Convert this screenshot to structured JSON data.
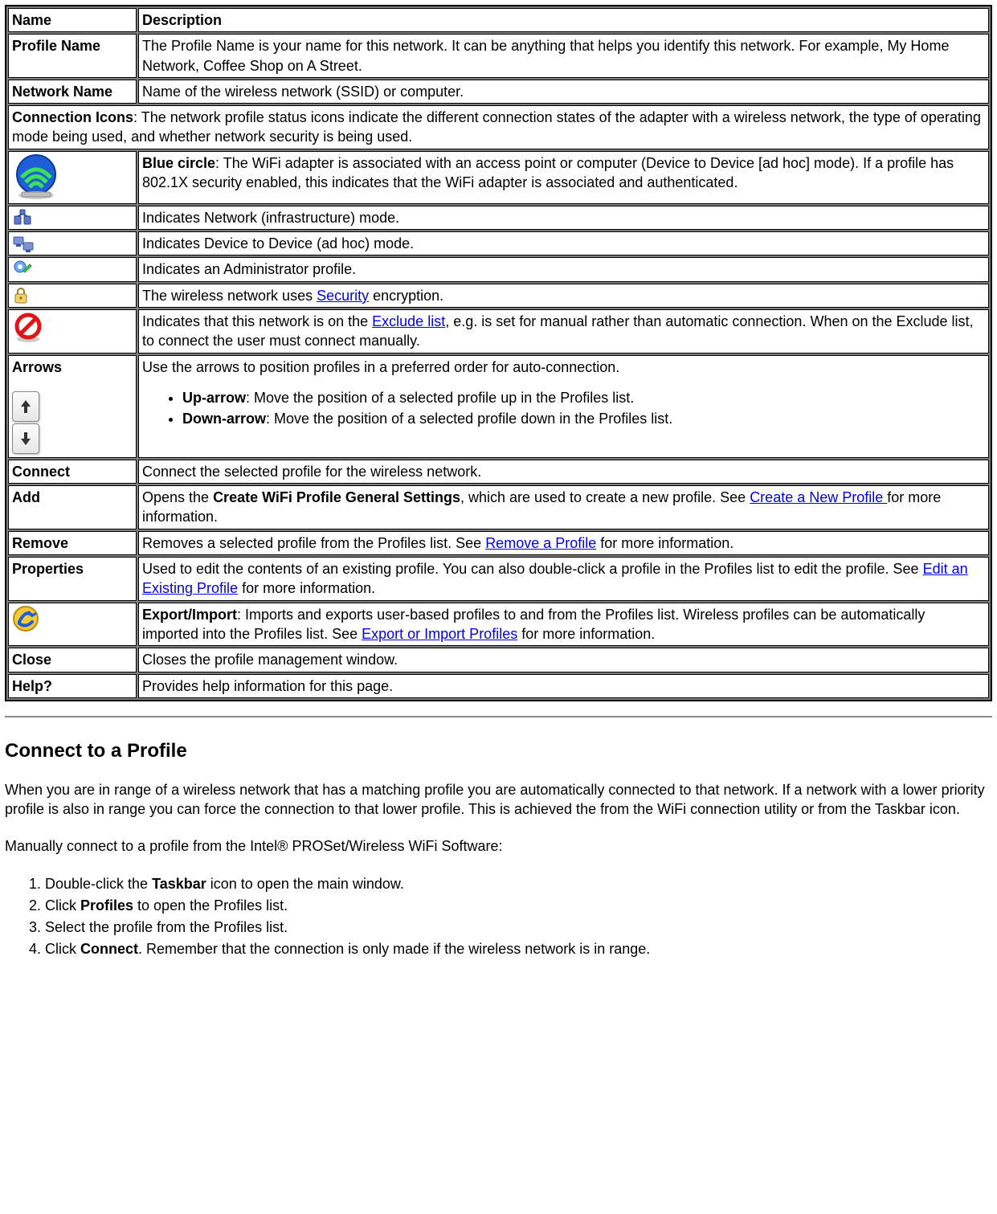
{
  "headers": {
    "name": "Name",
    "description": "Description"
  },
  "rows": {
    "profile_name": {
      "name": "Profile Name",
      "desc": "The Profile Name is your name for this network. It can be anything that helps you identify this network. For example, My Home Network, Coffee Shop on A Street."
    },
    "network_name": {
      "name": "Network Name",
      "desc": "Name of the wireless network (SSID) or computer."
    },
    "connection_icons": {
      "label": "Connection Icons",
      "desc": ": The network profile status icons indicate the different connection states of the adapter with a wireless network, the type of operating mode being used, and whether network security is being used."
    },
    "blue_circle": {
      "label": "Blue circle",
      "desc": ": The WiFi adapter is associated with an access point or computer (Device to Device [ad hoc] mode). If a profile has 802.1X security enabled, this indicates that the WiFi adapter is associated and authenticated."
    },
    "infra": {
      "desc": "Indicates Network (infrastructure) mode."
    },
    "adhoc": {
      "desc": "Indicates Device to Device (ad hoc) mode."
    },
    "admin": {
      "desc": "Indicates an Administrator profile."
    },
    "security": {
      "pre": "The wireless network uses ",
      "link": "Security",
      "post": " encryption."
    },
    "exclude": {
      "pre": "Indicates that this network is on the ",
      "link": "Exclude list",
      "post": ", e.g. is set for manual rather than automatic connection. When on the Exclude list, to connect the user must connect manually."
    },
    "arrows": {
      "name": "Arrows",
      "intro": "Use the arrows to position profiles in a preferred order for auto-connection.",
      "up_label": "Up-arrow",
      "up_desc": ": Move the position of a selected profile up in the Profiles list.",
      "down_label": "Down-arrow",
      "down_desc": ": Move the position of a selected profile down in the Profiles list."
    },
    "connect": {
      "name": "Connect",
      "desc": "Connect the selected profile for the wireless network."
    },
    "add": {
      "name": "Add",
      "pre": "Opens the ",
      "bold": "Create WiFi Profile General Settings",
      "mid": ", which are used to create a new profile. See ",
      "link": "Create a New Profile ",
      "post": "for more information."
    },
    "remove": {
      "name": "Remove",
      "pre": "Removes a selected profile from the Profiles list. See ",
      "link": "Remove a Profile",
      "post": " for more information."
    },
    "properties": {
      "name": "Properties",
      "pre": "Used to edit the contents of an existing profile. You can also double-click a profile in the Profiles list to edit the profile. See ",
      "link": "Edit an Existing Profile",
      "post": " for more information."
    },
    "export": {
      "label": "Export/Import",
      "pre": ": Imports and exports user-based profiles to and from the Profiles list. Wireless profiles can be automatically imported into the Profiles list. See ",
      "link": "Export or Import Profiles",
      "post": " for more information."
    },
    "close": {
      "name": "Close",
      "desc": "Closes the profile management window."
    },
    "help": {
      "name": "Help?",
      "desc": "Provides help information for this page."
    }
  },
  "section": {
    "title": "Connect to a Profile",
    "p1": "When you are in range of a wireless network that has a matching profile you are automatically connected to that network. If a network with a lower priority profile is also in range you can force the connection to that lower profile. This is achieved the from the WiFi connection utility or from the Taskbar icon.",
    "p2": "Manually connect to a profile from the Intel® PROSet/Wireless WiFi Software:",
    "steps": {
      "s1_pre": "Double-click the ",
      "s1_bold": "Taskbar",
      "s1_post": " icon to open the main window.",
      "s2_pre": "Click ",
      "s2_bold": "Profiles",
      "s2_post": " to open the Profiles list.",
      "s3": "Select the profile from the Profiles list.",
      "s4_pre": "Click ",
      "s4_bold": "Connect",
      "s4_post": ". Remember that the connection is only made if the wireless network is in range."
    }
  }
}
